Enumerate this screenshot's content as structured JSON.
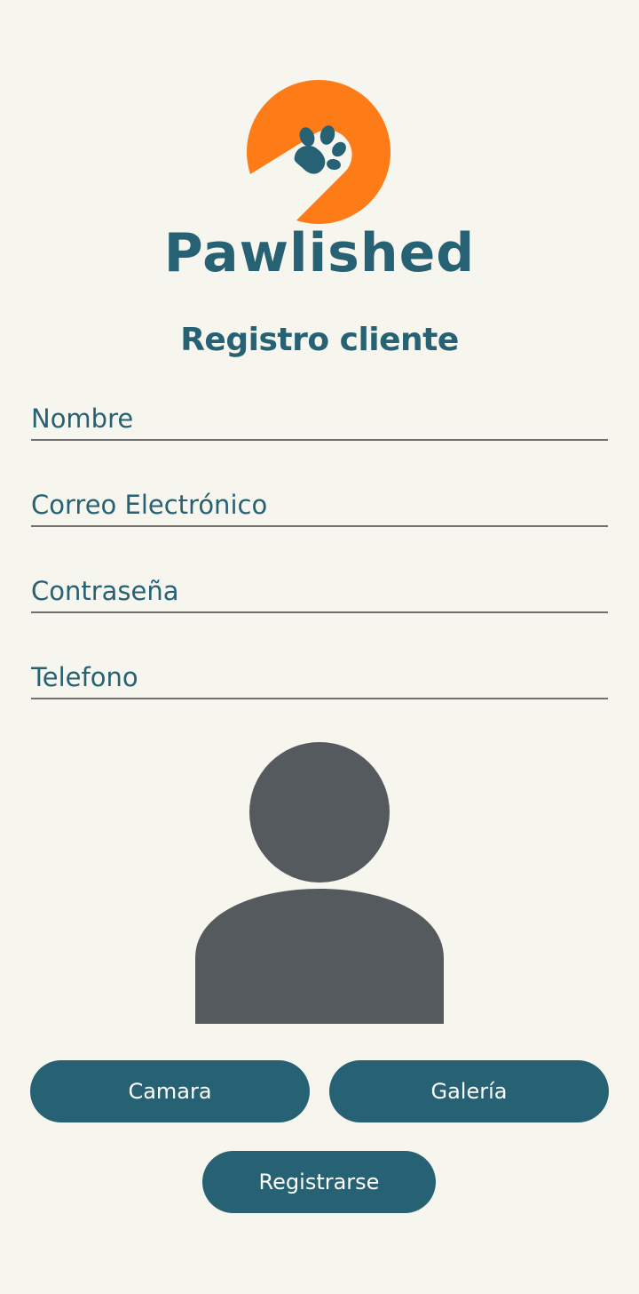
{
  "app": {
    "brand_name": "Pawlished"
  },
  "screen": {
    "title": "Registro cliente"
  },
  "form": {
    "fields": [
      {
        "placeholder": "Nombre",
        "value": ""
      },
      {
        "placeholder": "Correo Electrónico",
        "value": ""
      },
      {
        "placeholder": "Contraseña",
        "value": ""
      },
      {
        "placeholder": "Telefono",
        "value": ""
      }
    ]
  },
  "photo": {
    "icon": "person-placeholder-icon"
  },
  "buttons": {
    "camera_label": "Camara",
    "gallery_label": "Galería",
    "register_label": "Registrarse"
  },
  "colors": {
    "background": "#f6f5ee",
    "primary": "#276174",
    "accent": "#fd7c17",
    "avatar": "#545a5e",
    "underline": "#707070"
  }
}
